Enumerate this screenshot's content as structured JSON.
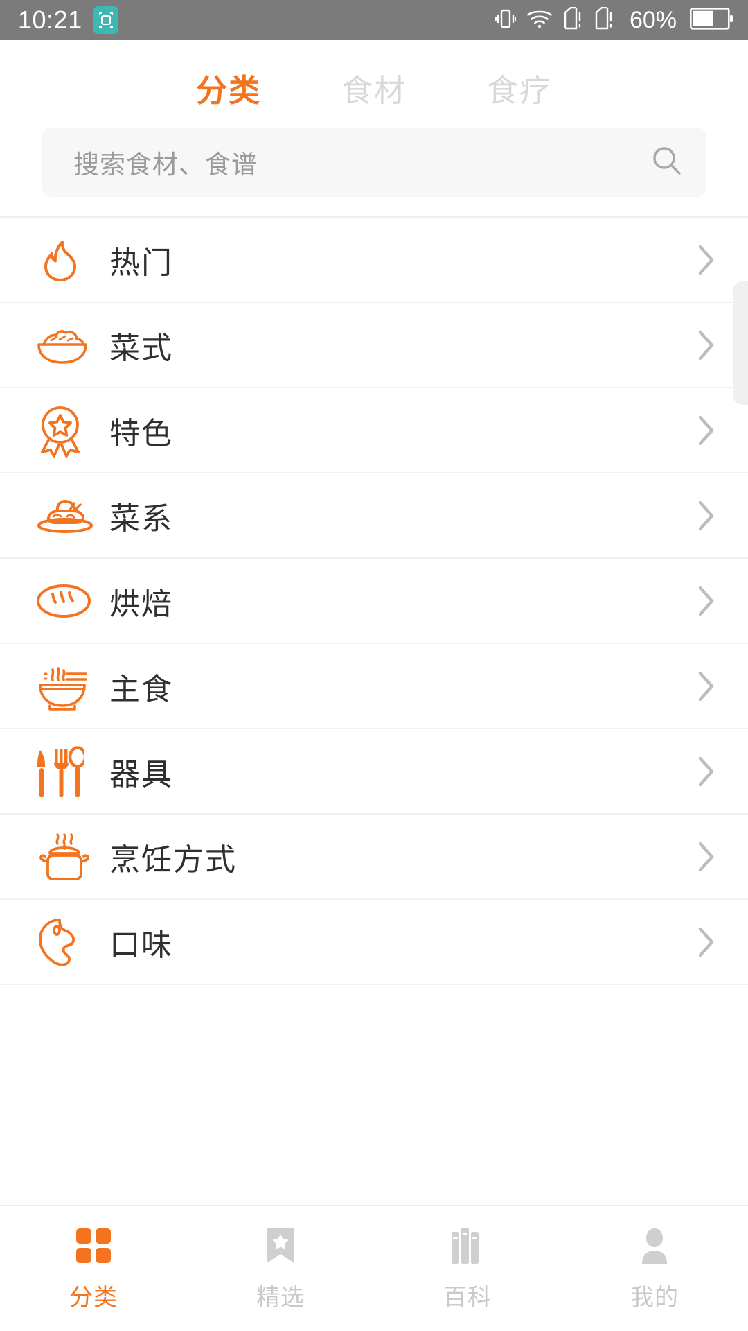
{
  "status_bar": {
    "time": "10:21",
    "badge_icon": "screenshot-capture-icon",
    "badge_color": "#3fb8b3",
    "icons": [
      "vibrate-icon",
      "wifi-icon",
      "sim1-icon",
      "sim2-icon"
    ],
    "battery_percent": "60%",
    "battery_icon": "battery-icon",
    "background": "#7b7b7b"
  },
  "tabs": [
    {
      "label": "分类",
      "active": true
    },
    {
      "label": "食材",
      "active": false
    },
    {
      "label": "食疗",
      "active": false
    }
  ],
  "search": {
    "placeholder": "搜索食材、食谱",
    "value": "",
    "icon": "search-icon"
  },
  "categories": [
    {
      "label": "热门",
      "icon": "flame-icon",
      "chevron": "chevron-right-icon"
    },
    {
      "label": "菜式",
      "icon": "salad-bowl-icon",
      "chevron": "chevron-right-icon"
    },
    {
      "label": "特色",
      "icon": "medal-star-icon",
      "chevron": "chevron-right-icon"
    },
    {
      "label": "菜系",
      "icon": "plated-dish-icon",
      "chevron": "chevron-right-icon"
    },
    {
      "label": "烘焙",
      "icon": "bread-loaf-icon",
      "chevron": "chevron-right-icon"
    },
    {
      "label": "主食",
      "icon": "noodle-bowl-icon",
      "chevron": "chevron-right-icon"
    },
    {
      "label": "器具",
      "icon": "cutlery-icon",
      "chevron": "chevron-right-icon"
    },
    {
      "label": "烹饪方式",
      "icon": "cooking-pot-icon",
      "chevron": "chevron-right-icon"
    },
    {
      "label": "口味",
      "icon": "taste-palette-icon",
      "chevron": "chevron-right-icon"
    }
  ],
  "bottom_nav": [
    {
      "label": "分类",
      "icon": "grid-icon",
      "active": true
    },
    {
      "label": "精选",
      "icon": "bookmark-star-icon",
      "active": false
    },
    {
      "label": "百科",
      "icon": "books-icon",
      "active": false
    },
    {
      "label": "我的",
      "icon": "person-icon",
      "active": false
    }
  ],
  "colors": {
    "accent": "#f4731f",
    "inactive": "#c9c9c9",
    "text": "#2f2f2f",
    "divider": "#f1f1f1",
    "search_bg": "#f7f7f7"
  }
}
